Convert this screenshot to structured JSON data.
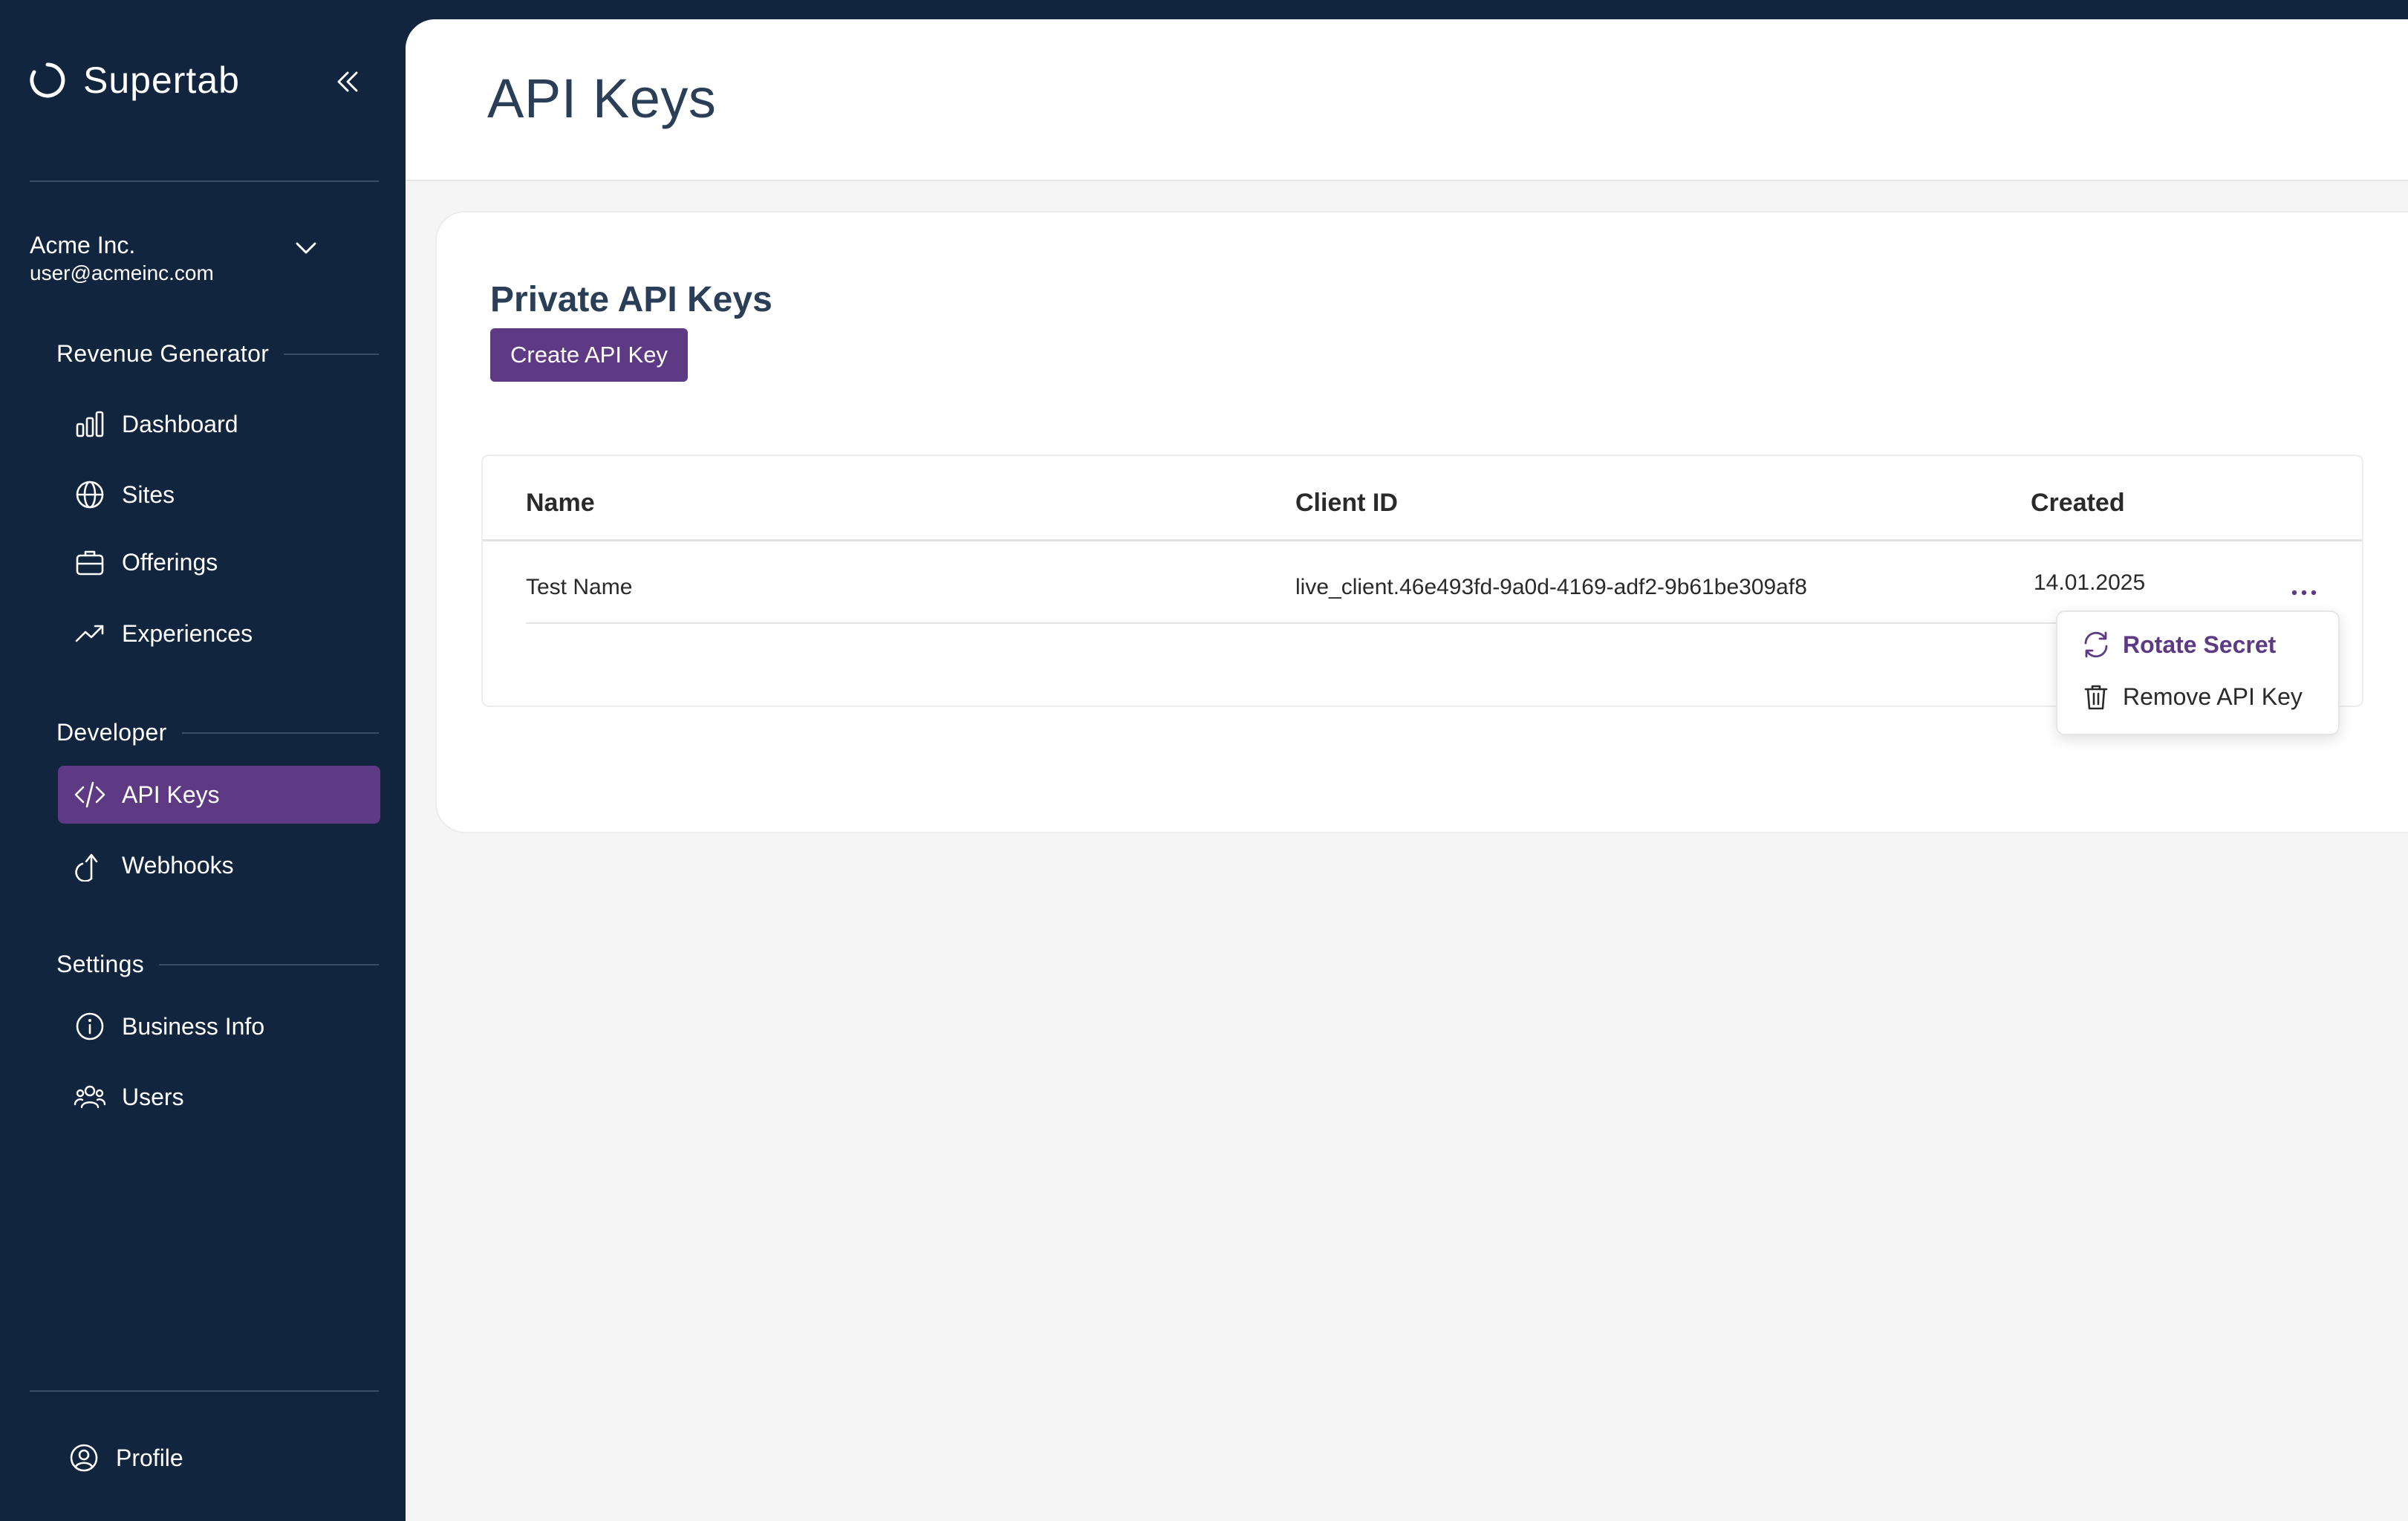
{
  "brand": {
    "name": "Supertab",
    "icon": "brand-ring-icon"
  },
  "account": {
    "name": "Acme Inc.",
    "email": "user@acmeinc.com"
  },
  "sidebar": {
    "sections": [
      {
        "title": "Revenue Generator",
        "items": [
          {
            "label": "Dashboard",
            "icon": "bar-chart-icon"
          },
          {
            "label": "Sites",
            "icon": "globe-icon"
          },
          {
            "label": "Offerings",
            "icon": "briefcase-icon"
          },
          {
            "label": "Experiences",
            "icon": "trending-up-icon"
          }
        ]
      },
      {
        "title": "Developer",
        "items": [
          {
            "label": "API Keys",
            "icon": "code-icon",
            "active": true
          },
          {
            "label": "Webhooks",
            "icon": "webhook-icon"
          }
        ]
      },
      {
        "title": "Settings",
        "items": [
          {
            "label": "Business Info",
            "icon": "info-icon"
          },
          {
            "label": "Users",
            "icon": "users-icon"
          }
        ]
      }
    ],
    "profile": {
      "label": "Profile",
      "icon": "user-circle-icon"
    }
  },
  "page": {
    "title": "API Keys",
    "card_title": "Private API Keys",
    "create_button": "Create API Key"
  },
  "table": {
    "columns": [
      "Name",
      "Client ID",
      "Created"
    ],
    "rows": [
      {
        "name": "Test Name",
        "client_id": "live_client.46e493fd-9a0d-4169-adf2-9b61be309af8",
        "created": "14.01.2025"
      }
    ]
  },
  "row_menu": {
    "rotate_label": "Rotate Secret",
    "remove_label": "Remove API Key"
  },
  "colors": {
    "sidebar_bg": "#11253e",
    "accent": "#5e3a85",
    "heading": "#2a3f57",
    "content_bg": "#f5f5f5"
  }
}
